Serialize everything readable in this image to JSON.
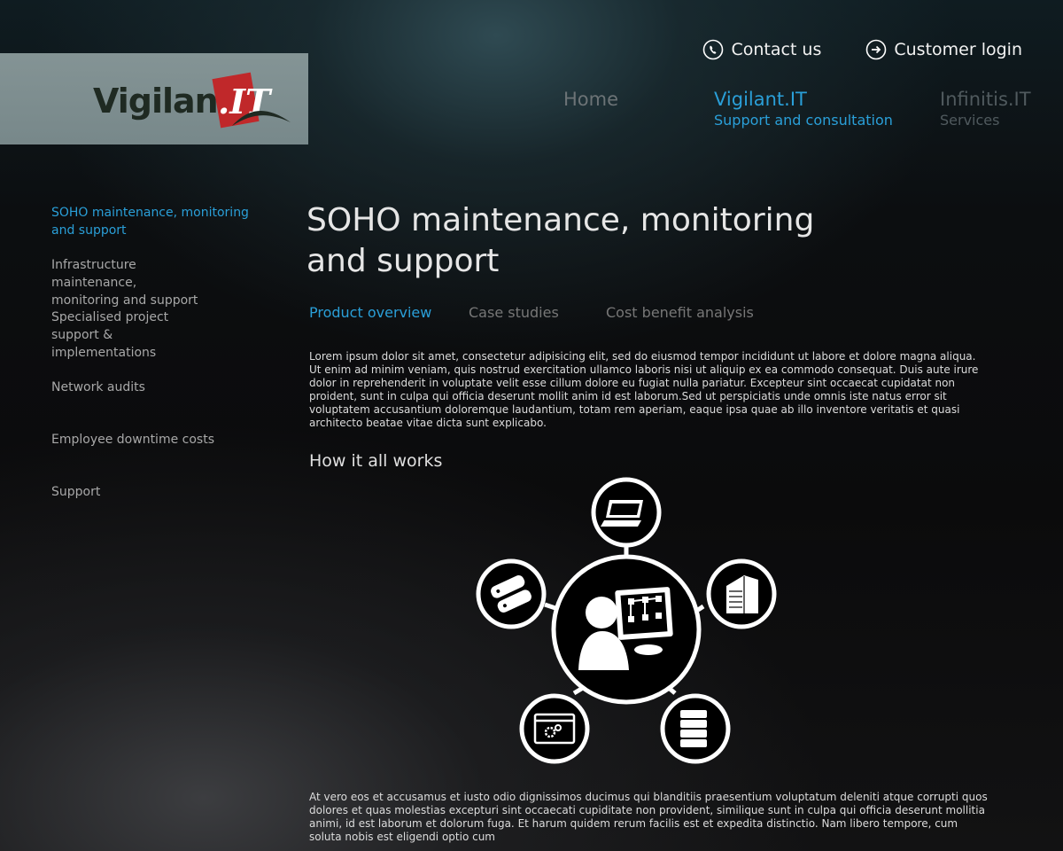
{
  "header": {
    "contact_label": "Contact us",
    "login_label": "Customer login",
    "logo_text": "Vigilant",
    "logo_mark_text": ".IT"
  },
  "nav": [
    {
      "title": "Home",
      "subtitle": ""
    },
    {
      "title": "Vigilant.IT",
      "subtitle": "Support and consultation"
    },
    {
      "title": "Infinitis.IT",
      "subtitle": "Services"
    }
  ],
  "sidebar": {
    "items": [
      {
        "label": "SOHO maintenance, monitoring and support",
        "active": true
      },
      {
        "label": "Infrastructure maintenance, monitoring and support",
        "active": false
      },
      {
        "label": "Specialised project support & implementations",
        "active": false
      },
      {
        "label": "Network audits",
        "active": false
      },
      {
        "label": "Employee downtime costs",
        "active": false
      },
      {
        "label": "Support",
        "active": false
      }
    ]
  },
  "main": {
    "title": "SOHO maintenance, monitoring and support",
    "tabs": [
      {
        "label": "Product overview",
        "active": true
      },
      {
        "label": "Case studies",
        "active": false
      },
      {
        "label": "Cost benefit analysis",
        "active": false
      }
    ],
    "intro": "Lorem ipsum dolor sit amet, consectetur adipisicing elit, sed do eiusmod tempor incididunt ut labore et dolore magna aliqua. Ut enim ad minim veniam, quis nostrud exercitation ullamco laboris nisi ut aliquip ex ea commodo consequat. Duis aute irure dolor in reprehenderit in voluptate velit esse cillum dolore eu fugiat nulla pariatur. Excepteur sint occaecat cupidatat non proident, sunt in culpa qui officia deserunt mollit anim id est laborum.Sed ut perspiciatis unde omnis iste natus error sit voluptatem accusantium doloremque laudantium, totam rem aperiam, eaque ipsa quae ab illo inventore veritatis et quasi architecto beatae vitae dicta sunt explicabo.",
    "how_title": "How it all works",
    "outro": "At vero eos et accusamus et iusto odio dignissimos ducimus qui blanditiis praesentium voluptatum deleniti atque corrupti quos dolores et quas molestias excepturi sint occaecati cupiditate non provident, similique sunt in culpa qui officia deserunt mollitia animi, id est laborum et dolorum fuga. Et harum quidem rerum facilis est et expedita distinctio. Nam libero tempore, cum soluta nobis est eligendi optio cum"
  },
  "diagram": {
    "center_icon": "user-monitor-icon",
    "satellites": [
      "laptop-icon",
      "office-building-icon",
      "database-icon",
      "settings-window-icon",
      "servers-icon"
    ]
  },
  "colors": {
    "accent": "#2a9fd8",
    "logo_red": "#c0282a",
    "inactive_text": "#777777"
  }
}
